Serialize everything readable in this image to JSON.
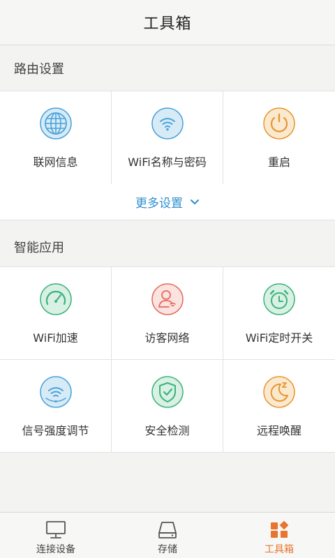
{
  "header": {
    "title": "工具箱"
  },
  "router_section": {
    "title": "路由设置",
    "items": [
      {
        "label": "联网信息",
        "icon": "globe-icon"
      },
      {
        "label": "WiFi名称与密码",
        "icon": "wifi-icon"
      },
      {
        "label": "重启",
        "icon": "power-icon"
      }
    ],
    "more_label": "更多设置"
  },
  "smart_section": {
    "title": "智能应用",
    "items": [
      {
        "label": "WiFi加速",
        "icon": "speedometer-icon"
      },
      {
        "label": "访客网络",
        "icon": "guest-user-icon"
      },
      {
        "label": "WiFi定时开关",
        "icon": "alarm-clock-icon"
      },
      {
        "label": "信号强度调节",
        "icon": "signal-strength-icon"
      },
      {
        "label": "安全检测",
        "icon": "shield-check-icon"
      },
      {
        "label": "远程唤醒",
        "icon": "moon-sleep-icon"
      }
    ]
  },
  "tabbar": {
    "tabs": [
      {
        "label": "连接设备",
        "icon": "monitor-icon",
        "active": false
      },
      {
        "label": "存储",
        "icon": "storage-drive-icon",
        "active": false
      },
      {
        "label": "工具箱",
        "icon": "toolbox-grid-icon",
        "active": true
      }
    ]
  },
  "colors": {
    "blue": "#4aa3d8",
    "orange": "#e8962f",
    "green": "#3bb37a",
    "red": "#e46a5e",
    "active_tab": "#e8742f",
    "link": "#2f8fcf"
  }
}
